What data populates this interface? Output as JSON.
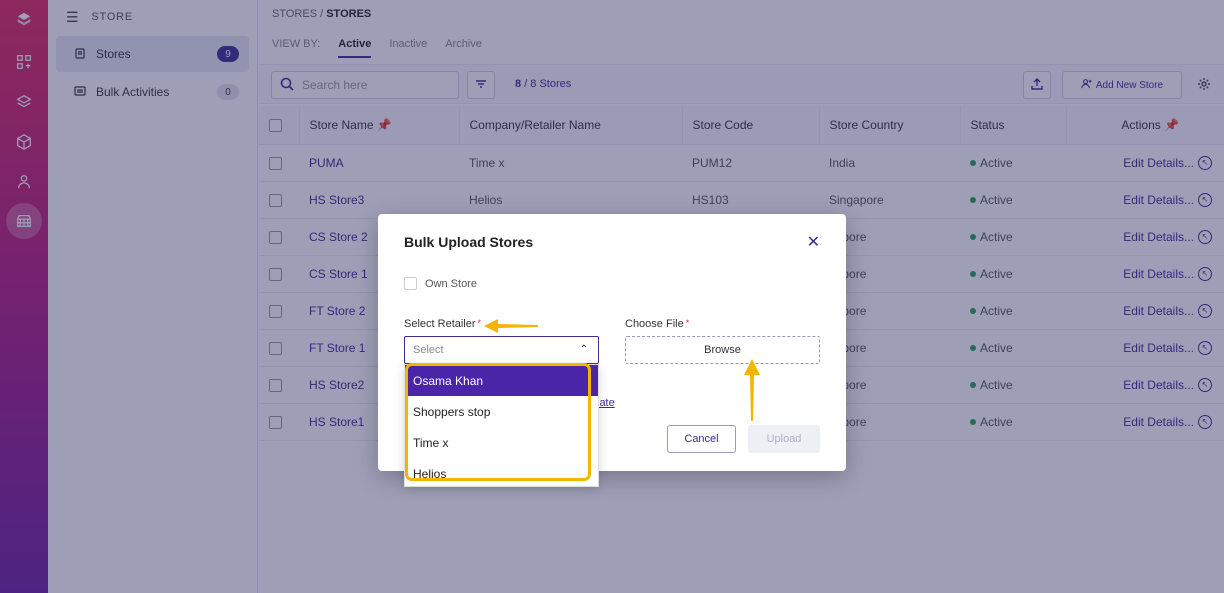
{
  "sidebar": {
    "header": "STORE",
    "items": [
      {
        "label": "Stores",
        "count": "9"
      },
      {
        "label": "Bulk Activities",
        "count": "0"
      }
    ]
  },
  "breadcrumb": {
    "parent": "STORES",
    "separator": "/",
    "current": "STORES"
  },
  "view_by": {
    "label": "VIEW BY:",
    "tabs": [
      "Active",
      "Inactive",
      "Archive"
    ]
  },
  "toolbar": {
    "search_placeholder": "Search here",
    "count_shown": "8",
    "count_total": "/ 8 Stores",
    "add_label": "Add New Store"
  },
  "table": {
    "columns": [
      "Store Name",
      "Company/Retailer Name",
      "Store Code",
      "Store Country",
      "Status",
      "Actions"
    ],
    "rows": [
      {
        "name": "PUMA",
        "company": "Time x",
        "code": "PUM12",
        "country": "India",
        "status": "Active",
        "action": "Edit Details..."
      },
      {
        "name": "HS Store3",
        "company": "Helios",
        "code": "HS103",
        "country": "Singapore",
        "status": "Active",
        "action": "Edit Details..."
      },
      {
        "name": "CS Store 2",
        "company": "",
        "code": "",
        "country": "gapore",
        "status": "Active",
        "action": "Edit Details..."
      },
      {
        "name": "CS Store 1",
        "company": "",
        "code": "",
        "country": "gapore",
        "status": "Active",
        "action": "Edit Details..."
      },
      {
        "name": "FT Store 2",
        "company": "",
        "code": "",
        "country": "gapore",
        "status": "Active",
        "action": "Edit Details..."
      },
      {
        "name": "FT Store 1",
        "company": "",
        "code": "",
        "country": "gapore",
        "status": "Active",
        "action": "Edit Details..."
      },
      {
        "name": "HS Store2",
        "company": "",
        "code": "",
        "country": "gapore",
        "status": "Active",
        "action": "Edit Details..."
      },
      {
        "name": "HS Store1",
        "company": "",
        "code": "",
        "country": "gapore",
        "status": "Active",
        "action": "Edit Details..."
      }
    ]
  },
  "modal": {
    "title": "Bulk Upload Stores",
    "own_store_label": "Own Store",
    "retailer_label": "Select Retailer",
    "retailer_placeholder": "Select",
    "file_label": "Choose File",
    "required_mark": "*",
    "browse_label": "Browse",
    "template_link": "late",
    "cancel_label": "Cancel",
    "upload_label": "Upload"
  },
  "dropdown": {
    "options": [
      "Osama Khan",
      "Shoppers stop",
      "Time x",
      "Helios"
    ]
  },
  "colors": {
    "accent": "#3b2e8e",
    "highlight": "#f4b400",
    "selected_option": "#4a25a8",
    "status_active": "#1fa35a"
  }
}
